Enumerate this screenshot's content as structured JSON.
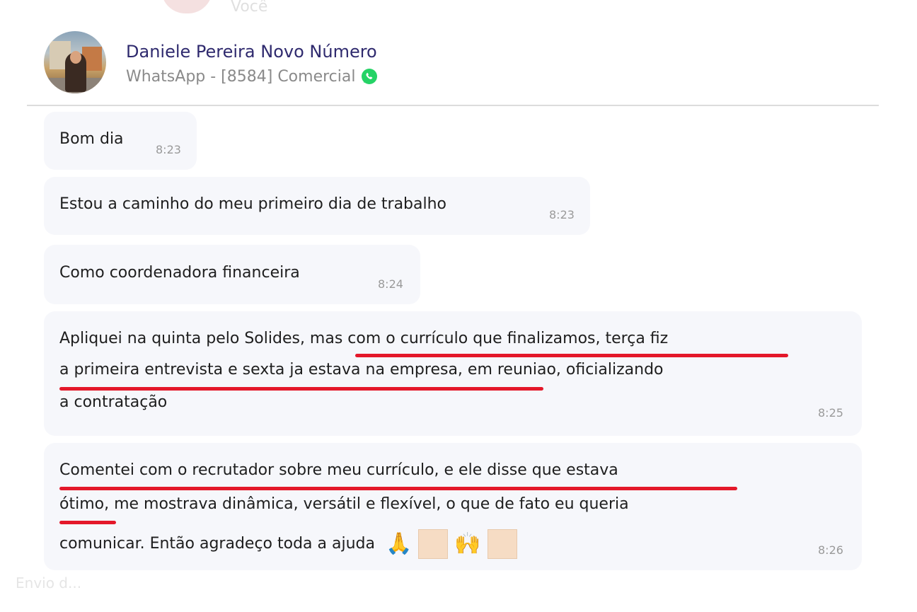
{
  "ghost_top": {
    "label": "Você"
  },
  "header": {
    "contact_name": "Daniele Pereira Novo Número",
    "channel": "WhatsApp - [8584] Comercial",
    "channel_icon": "whatsapp-icon"
  },
  "messages": [
    {
      "text": "Bom dia",
      "time": "8:23"
    },
    {
      "text": "Estou a caminho do meu primeiro dia de trabalho",
      "time": "8:23"
    },
    {
      "text": "Como coordenadora financeira",
      "time": "8:24"
    },
    {
      "lines": [
        "Apliquei na quinta pelo Solides, mas com o currículo que finalizamos, terça fiz",
        "a primeira entrevista e sexta ja estava na empresa, em reuniao, oficializando",
        "a contratação"
      ],
      "time": "8:25"
    },
    {
      "lines": [
        "Comentei com o recrutador sobre meu currículo, e ele disse que estava",
        "ótimo, me mostrava dinâmica, versátil e flexível, o que de fato eu queria",
        "comunicar. Então agradeço toda a ajuda"
      ],
      "emojis": [
        "🙏",
        "🙌"
      ],
      "time": "8:26"
    }
  ],
  "ghost_bottom": {
    "label": "Envio d..."
  },
  "colors": {
    "contact_name": "#2f2a6e",
    "bubble_bg": "#f6f7fb",
    "underline": "#e4182a",
    "whatsapp": "#25d366"
  }
}
